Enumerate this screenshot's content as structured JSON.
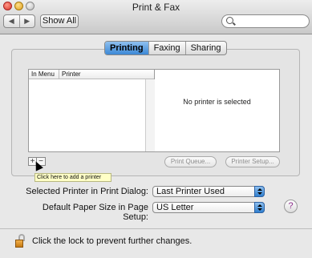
{
  "window": {
    "title": "Print & Fax"
  },
  "toolbar": {
    "back": "◀",
    "forward": "▶",
    "show_all": "Show All",
    "search_placeholder": ""
  },
  "tabs": [
    {
      "label": "Printing",
      "active": true
    },
    {
      "label": "Faxing",
      "active": false
    },
    {
      "label": "Sharing",
      "active": false
    }
  ],
  "printer_list": {
    "columns": [
      "In Menu",
      "Printer"
    ],
    "rows": []
  },
  "detail": {
    "message": "No printer is selected"
  },
  "list_controls": {
    "add": "+",
    "remove": "−"
  },
  "tooltip": "Click here to add a printer",
  "buttons": {
    "print_queue": "Print Queue...",
    "printer_setup": "Printer Setup..."
  },
  "settings": {
    "selected_printer_label": "Selected Printer in Print Dialog:",
    "selected_printer_value": "Last Printer Used",
    "paper_size_label": "Default Paper Size in Page Setup:",
    "paper_size_value": "US Letter"
  },
  "help": "?",
  "footer": {
    "lock_message": "Click the lock to prevent further changes."
  },
  "colors": {
    "accent": "#3c88d6",
    "tooltip_bg": "#ffffc6"
  }
}
